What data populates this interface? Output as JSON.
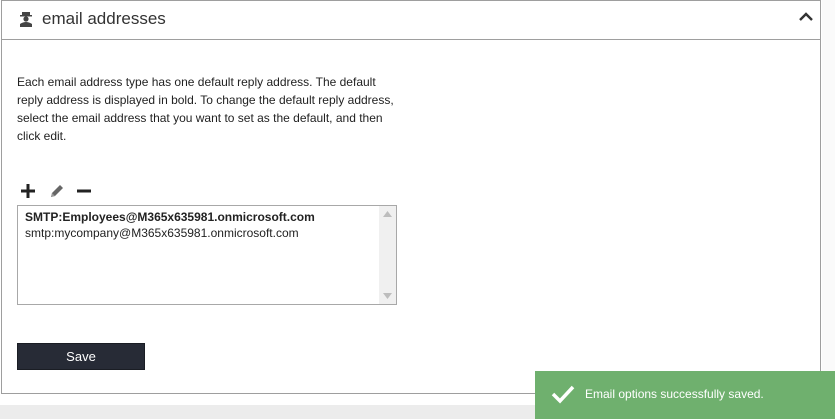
{
  "panel": {
    "title": "email addresses",
    "icon": "user-agent-icon",
    "collapse_icon": "chevron-up-icon"
  },
  "description": "Each email address type has one default reply address. The default reply address is displayed in bold. To change the default reply address, select the email address that you want to set as the default, and then click edit.",
  "toolbar": {
    "add_icon": "plus-icon",
    "edit_icon": "pencil-icon",
    "remove_icon": "minus-icon"
  },
  "addresses": [
    {
      "text": "SMTP:Employees@M365x635981.onmicrosoft.com",
      "default": true
    },
    {
      "text": "smtp:mycompany@M365x635981.onmicrosoft.com",
      "default": false
    }
  ],
  "save_button": "Save",
  "toast": {
    "message": "Email options successfully saved.",
    "icon": "checkmark-icon",
    "color": "#6fb06e"
  },
  "colors": {
    "button_bg": "#272b36",
    "border": "#9e9e9e"
  }
}
